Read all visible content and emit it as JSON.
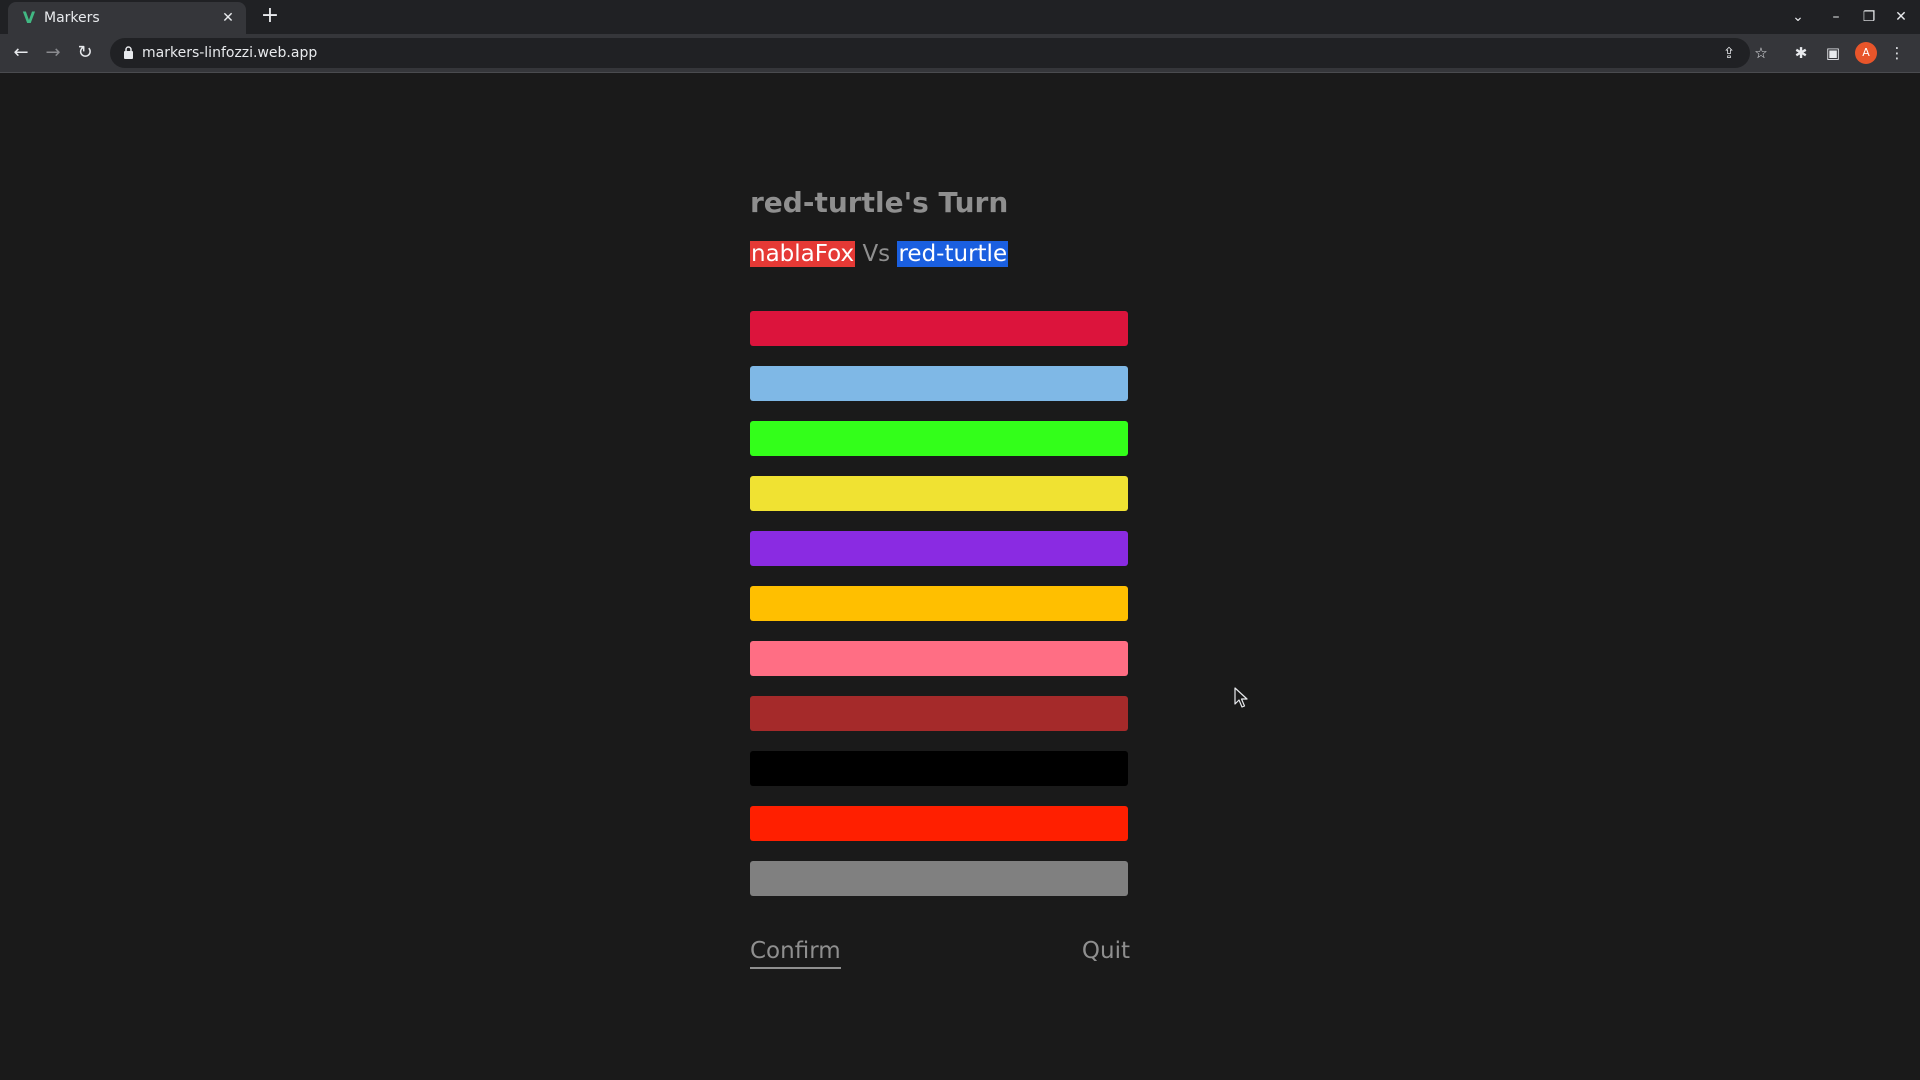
{
  "browser": {
    "tab_title": "Markers",
    "url": "markers-linfozzi.web.app",
    "avatar_letter": "A"
  },
  "game": {
    "turn_title": "red-turtle's Turn",
    "player1": "nablaFox",
    "vs": "Vs",
    "player2": "red-turtle",
    "player1_color": "#e53935",
    "player2_color": "#1a5fe0"
  },
  "colors": [
    "#dc143c",
    "#7fb8e6",
    "#33ff1a",
    "#f0e232",
    "#8a2be2",
    "#ffbf00",
    "#ff6e84",
    "#a52a2a",
    "#000000",
    "#ff1f00",
    "#808080"
  ],
  "actions": {
    "confirm_label": "Confirm",
    "quit_label": "Quit"
  }
}
